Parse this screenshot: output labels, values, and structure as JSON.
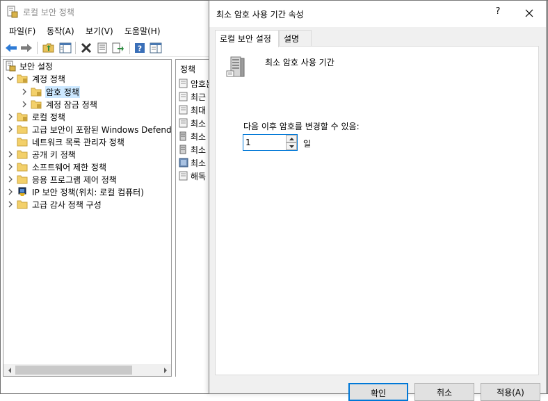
{
  "main_window": {
    "title": "로컬 보안 정책",
    "menu": [
      "파일(F)",
      "동작(A)",
      "보기(V)",
      "도움말(H)"
    ],
    "toolbar_icons": [
      "back-arrow-icon",
      "forward-arrow-icon",
      "up-folder-icon",
      "show-hide-tree-icon",
      "delete-icon",
      "properties-icon",
      "export-list-icon",
      "help-icon",
      "details-pane-icon"
    ]
  },
  "tree": {
    "items": [
      {
        "label": "보안 설정",
        "expanded": true
      },
      {
        "label": "계정 정책",
        "expanded": true
      },
      {
        "label": "암호 정책",
        "selected": true
      },
      {
        "label": "계정 잠금 정책"
      },
      {
        "label": "로컬 정책"
      },
      {
        "label": "고급 보안이 포함된 Windows Defender 방화벽"
      },
      {
        "label": "네트워크 목록 관리자 정책"
      },
      {
        "label": "공개 키 정책"
      },
      {
        "label": "소프트웨어 제한 정책"
      },
      {
        "label": "응용 프로그램 제어 정책"
      },
      {
        "label": "IP 보안 정책(위치: 로컬 컴퓨터)"
      },
      {
        "label": "고급 감사 정책 구성"
      }
    ]
  },
  "list": {
    "header": "정책",
    "rows": [
      "암호는",
      "최근",
      "최대",
      "최소",
      "최소",
      "최소",
      "최소",
      "해독"
    ]
  },
  "dialog": {
    "title": "최소 암호 사용 기간 속성",
    "help_glyph": "?",
    "tabs": [
      "로컬 보안 설정",
      "설명"
    ],
    "active_tab": "로컬 보안 설정",
    "policy_name": "최소 암호 사용 기간",
    "change_label": "다음 이후 암호를 변경할 수 있음:",
    "days_value": "1",
    "days_unit": "일",
    "buttons": {
      "ok": "확인",
      "cancel": "취소",
      "apply": "적용(A)"
    }
  },
  "colors": {
    "accent": "#0078d7",
    "selection": "#cce8ff",
    "dialog_bg": "#f0f0f0"
  }
}
